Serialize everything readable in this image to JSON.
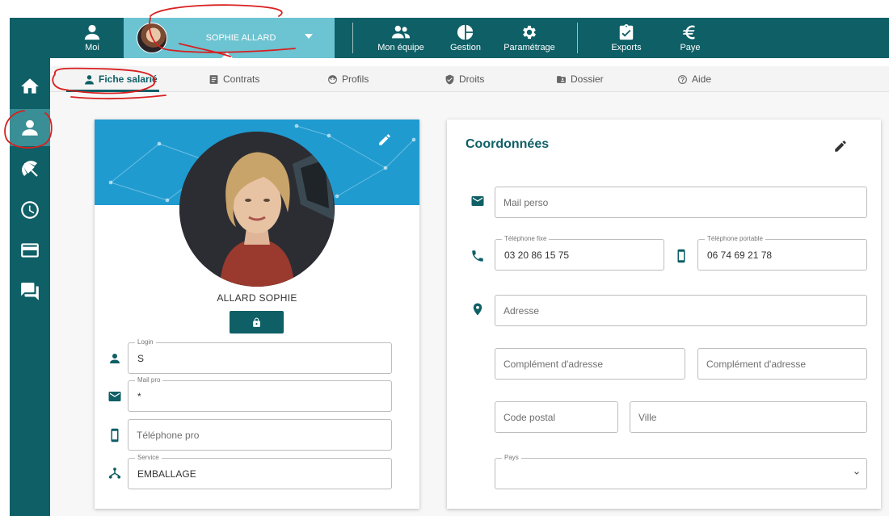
{
  "colors": {
    "primary": "#0e5f66",
    "accent": "#6cc3d1",
    "banner": "#1f9bd0",
    "annotation": "#d91f1f"
  },
  "topbar": {
    "moi": {
      "label": "Moi",
      "icon": "person-icon"
    },
    "user": {
      "name": "SOPHIE ALLARD",
      "icon": "chevron-down-icon"
    },
    "items": [
      {
        "label": "Mon équipe",
        "icon": "team-icon"
      },
      {
        "label": "Gestion",
        "icon": "pie-chart-icon"
      },
      {
        "label": "Paramétrage",
        "icon": "gear-icon"
      },
      {
        "label": "Exports",
        "icon": "clipboard-check-icon"
      },
      {
        "label": "Paye",
        "icon": "euro-icon"
      }
    ]
  },
  "sidebar": {
    "items": [
      {
        "icon": "home-icon",
        "active": false
      },
      {
        "icon": "person-icon",
        "active": true
      },
      {
        "icon": "beach-umbrella-icon",
        "active": false
      },
      {
        "icon": "clock-icon",
        "active": false
      },
      {
        "icon": "credit-card-icon",
        "active": false
      },
      {
        "icon": "chat-icon",
        "active": false
      }
    ]
  },
  "tabs": [
    {
      "label": "Fiche salarié",
      "icon": "person-icon",
      "active": true
    },
    {
      "label": "Contrats",
      "icon": "document-icon",
      "active": false
    },
    {
      "label": "Profils",
      "icon": "face-icon",
      "active": false
    },
    {
      "label": "Droits",
      "icon": "shield-icon",
      "active": false
    },
    {
      "label": "Dossier",
      "icon": "folder-icon",
      "active": false
    },
    {
      "label": "Aide",
      "icon": "help-icon",
      "active": false
    }
  ],
  "profile": {
    "name": "ALLARD SOPHIE",
    "login": {
      "label": "Login",
      "value": "S"
    },
    "mail_pro": {
      "label": "Mail pro",
      "value": "*"
    },
    "telephone_pro": {
      "placeholder": "Téléphone pro"
    },
    "service": {
      "label": "Service",
      "value": "EMBALLAGE"
    }
  },
  "coordonnees": {
    "title": "Coordonnées",
    "mail_perso": {
      "placeholder": "Mail perso"
    },
    "tel_fixe": {
      "label": "Téléphone fixe",
      "value": "03 20 86 15 75"
    },
    "tel_portable": {
      "label": "Téléphone portable",
      "value": "06 74 69 21 78"
    },
    "adresse": {
      "placeholder": "Adresse"
    },
    "complement_1": {
      "placeholder": "Complément d'adresse"
    },
    "complement_2": {
      "placeholder": "Complément d'adresse"
    },
    "code_postal": {
      "placeholder": "Code postal"
    },
    "ville": {
      "placeholder": "Ville"
    },
    "pays": {
      "label": "Pays",
      "value": ""
    }
  }
}
